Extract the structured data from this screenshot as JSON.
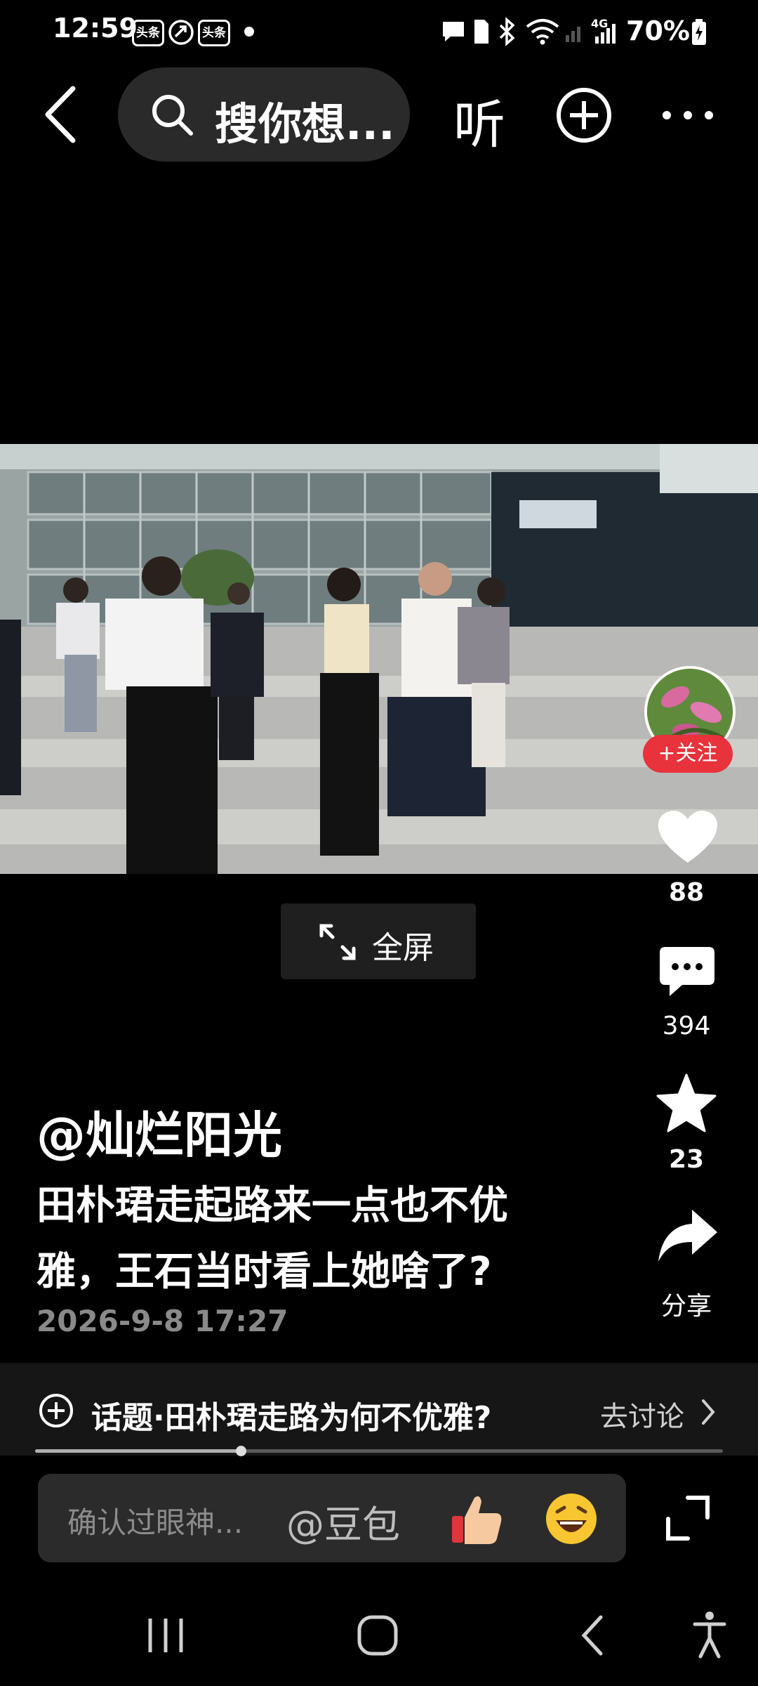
{
  "status_bar": {
    "time": "12:59",
    "app_badges": [
      "头条",
      "头条"
    ],
    "network": "4G",
    "battery": "70%"
  },
  "top_nav": {
    "search_text": "搜你想...",
    "listen_label": "听"
  },
  "video": {
    "fullscreen_label": "全屏"
  },
  "right_rail": {
    "follow_label": "+关注",
    "like_count": "88",
    "comment_count": "394",
    "favorite_count": "23",
    "share_label": "分享"
  },
  "post": {
    "author": "@灿烂阳光",
    "caption_line1": "田朴珺走起路来一点也不优",
    "caption_line2": "雅，王石当时看上她啥了?",
    "date": "2026-9-8 17:27"
  },
  "topic": {
    "text": "话题·田朴珺走路为何不优雅?",
    "action": "去讨论"
  },
  "progress": {
    "fraction": 0.3
  },
  "comment_bar": {
    "placeholder": "确认过眼神...",
    "mention": "@豆包"
  },
  "colors": {
    "background": "#000000",
    "follow_red": "#e8323c",
    "panel": "#161616"
  }
}
